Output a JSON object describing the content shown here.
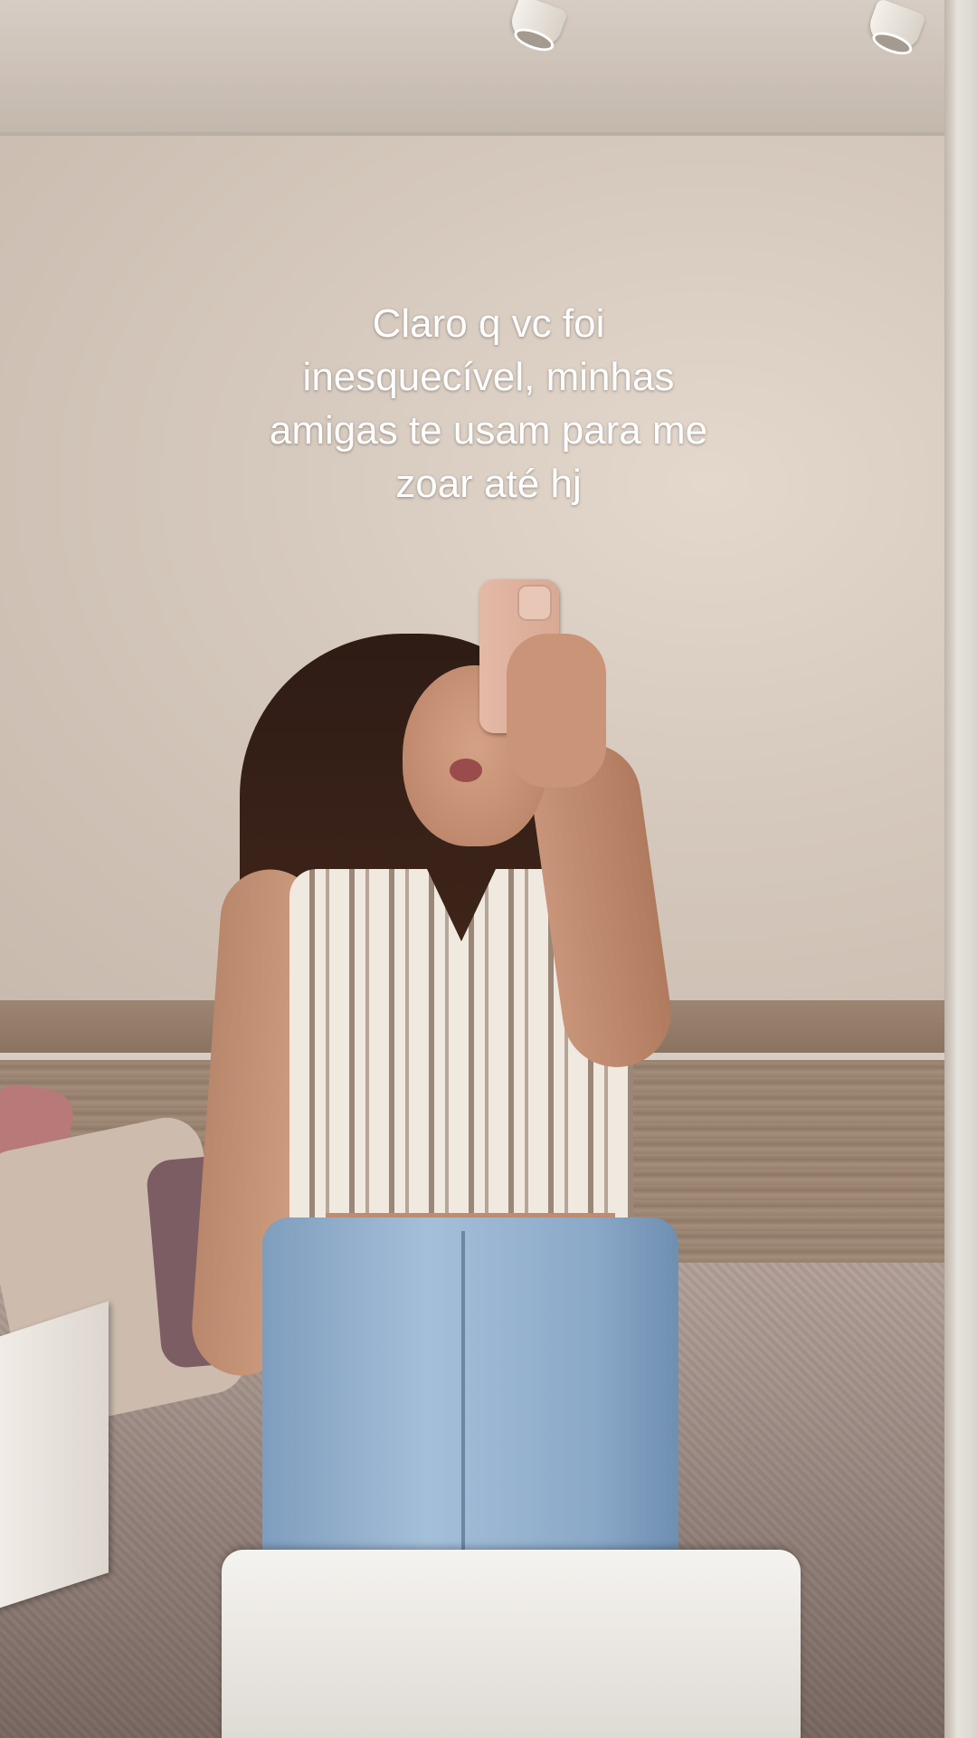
{
  "caption": {
    "lines": [
      "Claro q vc foi",
      "inesquecível, minhas",
      "amigas te usam para me",
      "zoar até hj"
    ]
  },
  "colors": {
    "caption_text": "#ffffff",
    "wall": "#d5c8bc",
    "jeans": "#a4bfd9"
  }
}
